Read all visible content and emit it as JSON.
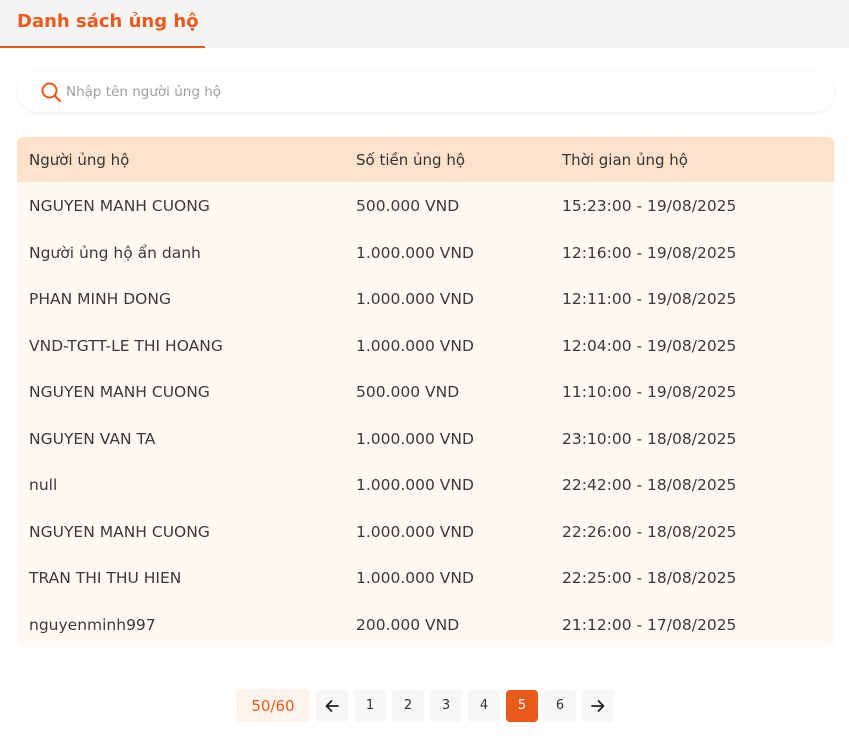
{
  "tab": {
    "label": "Danh sách ủng hộ"
  },
  "search": {
    "placeholder": "Nhập tên người ủng hộ",
    "value": ""
  },
  "table": {
    "headers": [
      "Người ủng hộ",
      "Số tiền ủng hộ",
      "Thời gian ủng hộ"
    ],
    "rows": [
      {
        "name": "NGUYEN MANH CUONG",
        "amount": "500.000 VND",
        "time": "15:23:00 - 19/08/2025"
      },
      {
        "name": "Người ủng hộ ẩn danh",
        "amount": "1.000.000 VND",
        "time": "12:16:00 - 19/08/2025"
      },
      {
        "name": "PHAN MINH DONG",
        "amount": "1.000.000 VND",
        "time": "12:11:00 - 19/08/2025"
      },
      {
        "name": "VND-TGTT-LE THI HOANG",
        "amount": "1.000.000 VND",
        "time": "12:04:00 - 19/08/2025"
      },
      {
        "name": "NGUYEN MANH CUONG",
        "amount": "500.000 VND",
        "time": "11:10:00 - 19/08/2025"
      },
      {
        "name": "NGUYEN VAN TA",
        "amount": "1.000.000 VND",
        "time": "23:10:00 - 18/08/2025"
      },
      {
        "name": "null",
        "amount": "1.000.000 VND",
        "time": "22:42:00 - 18/08/2025"
      },
      {
        "name": "NGUYEN MANH CUONG",
        "amount": "1.000.000 VND",
        "time": "22:26:00 - 18/08/2025"
      },
      {
        "name": "TRAN THI THU HIEN",
        "amount": "1.000.000 VND",
        "time": "22:25:00 - 18/08/2025"
      },
      {
        "name": "nguyenminh997",
        "amount": "200.000 VND",
        "time": "21:12:00 - 17/08/2025"
      }
    ]
  },
  "pagination": {
    "counter": "50/60",
    "pages": [
      "1",
      "2",
      "3",
      "4",
      "5",
      "6"
    ],
    "current": "5",
    "prev_icon": "arrow-left-icon",
    "next_icon": "arrow-right-icon"
  },
  "colors": {
    "accent": "#ea5a1c",
    "header_bg": "#ffe2cc",
    "row_bg": "#fff9f3"
  }
}
